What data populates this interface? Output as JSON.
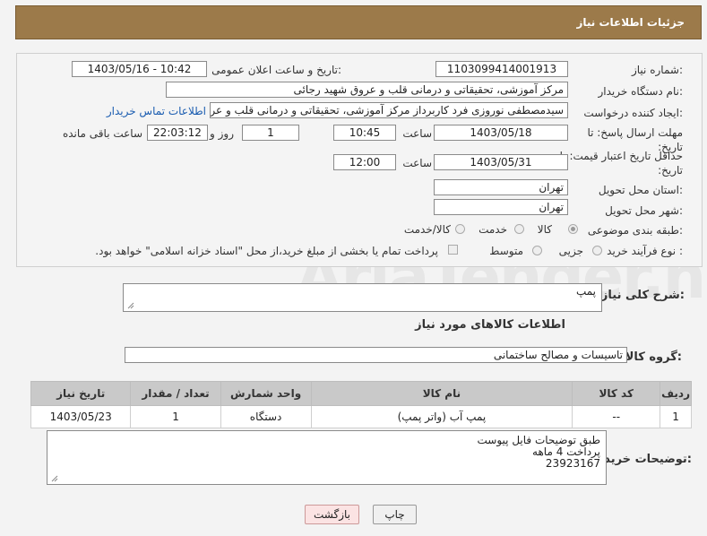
{
  "header": {
    "title": "جزئیات اطلاعات نیاز"
  },
  "fields": {
    "need_number_label": "شماره نیاز:",
    "need_number": "1103099414001913",
    "announce_label": "تاریخ و ساعت اعلان عمومی:",
    "announce_value": "1403/05/16 - 10:42",
    "buyer_org_label": "نام دستگاه خریدار:",
    "buyer_org": "مرکز آموزشی، تحقیقاتی و درمانی قلب و عروق شهید رجائی",
    "requester_label": "ایجاد کننده درخواست:",
    "requester": "سیدمصطفی نوروزی فرد کاربرداز مرکز آموزشی، تحقیقاتی و درمانی قلب و عروق",
    "contact_link": "اطلاعات تماس خریدار",
    "deadline_label": "مهلت ارسال پاسخ: تا تاریخ:",
    "deadline_date": "1403/05/18",
    "time_label": "ساعت",
    "deadline_time": "10:45",
    "days_value": "1",
    "days_label": "روز و",
    "remaining_value": "22:03:12",
    "remaining_label": "ساعت باقی مانده",
    "validity_label": "حداقل تاریخ اعتبار قیمت: تا تاریخ:",
    "validity_date": "1403/05/31",
    "validity_time": "12:00",
    "province_label": "استان محل تحویل:",
    "province": "تهران",
    "city_label": "شهر محل تحویل:",
    "city": "تهران",
    "category_label": "طبقه بندی موضوعی:",
    "category_options": [
      "کالا",
      "خدمت",
      "کالا/خدمت"
    ],
    "process_label": "نوع فرآیند خرید :",
    "process_options": [
      "جزیی",
      "متوسط"
    ],
    "payment_note": "پرداخت تمام یا بخشی از مبلغ خرید،از محل \"اسناد خزانه اسلامی\" خواهد بود."
  },
  "description": {
    "label": "شرح کلی نیاز:",
    "value": "پمپ"
  },
  "goods_title": "اطلاعات کالاهای مورد نیاز",
  "goods_group": {
    "label": "گروه کالا:",
    "value": "تاسیسات و مصالح ساختمانی"
  },
  "table": {
    "headers": [
      "ردیف",
      "کد کالا",
      "نام کالا",
      "واحد شمارش",
      "تعداد / مقدار",
      "تاریخ نیاز"
    ],
    "rows": [
      [
        "1",
        "--",
        "پمپ آب (واتر پمپ)",
        "دستگاه",
        "1",
        "1403/05/23"
      ]
    ]
  },
  "buyer_notes": {
    "label": "توضیحات خریدار:",
    "lines": [
      "طبق توضیحات فایل پیوست",
      "پرداخت 4 ماهه",
      "23923167"
    ]
  },
  "buttons": {
    "print": "چاپ",
    "back": "بازگشت"
  },
  "watermark": "AriaTender.neT",
  "colors": {
    "header_bg": "#9c7a4a",
    "link": "#1a5cb0",
    "back_button_bg": "#fbe3e3"
  }
}
